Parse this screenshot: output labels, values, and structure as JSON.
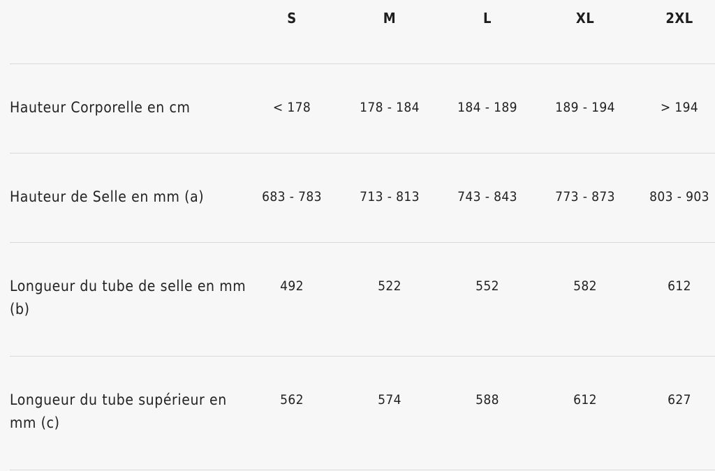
{
  "table": {
    "sizes": [
      "S",
      "M",
      "L",
      "XL",
      "2XL"
    ],
    "rows": [
      {
        "label": "Hauteur Corporelle en cm",
        "values": [
          "< 178",
          "178 - 184",
          "184 - 189",
          "189 - 194",
          "> 194"
        ]
      },
      {
        "label": "Hauteur de Selle en mm (a)",
        "values": [
          "683 - 783",
          "713 - 813",
          "743 - 843",
          "773 - 873",
          "803 - 903"
        ]
      },
      {
        "label": "Longueur du tube de selle en mm (b)",
        "values": [
          "492",
          "522",
          "552",
          "582",
          "612"
        ]
      },
      {
        "label": "Longueur du tube supérieur en mm (c)",
        "values": [
          "562",
          "574",
          "588",
          "612",
          "627"
        ]
      }
    ]
  }
}
